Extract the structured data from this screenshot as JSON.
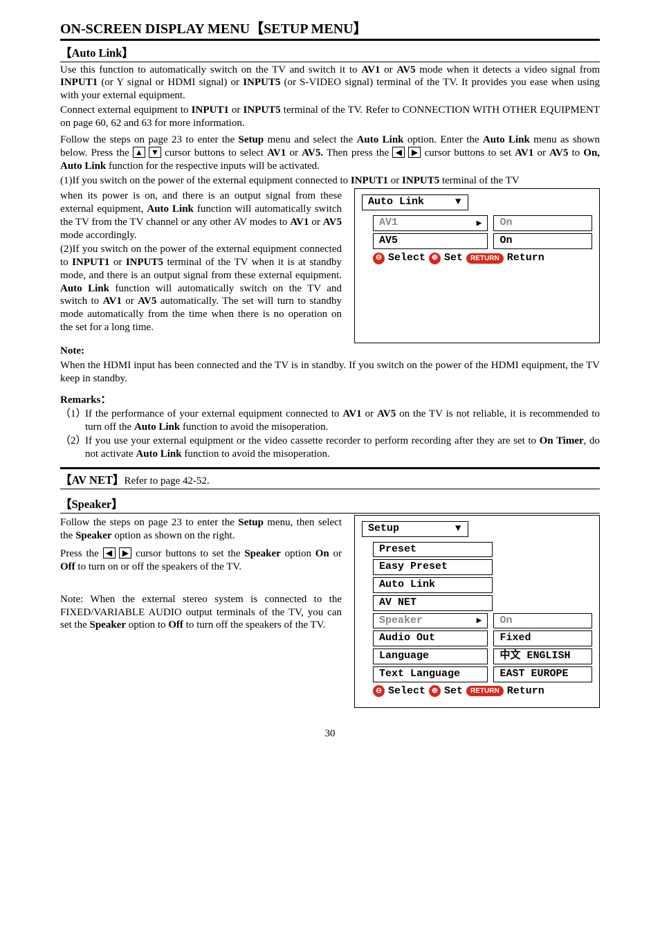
{
  "page": {
    "title": "ON-SCREEN DISPLAY MENU【SETUP MENU】",
    "number": "30"
  },
  "autolink": {
    "heading": "【Auto Link】",
    "p1a": "Use this function to automatically switch on the TV and switch it to ",
    "p1b": " or ",
    "p1c": " mode when it detects a video signal from ",
    "p1d": " (or Y signal or HDMI signal) or ",
    "p1e": " (or S-VIDEO signal) terminal of the TV. It provides you ease when using with your external equipment.",
    "p2a": "Connect external equipment to ",
    "p2b": " or ",
    "p2c": " terminal of the TV. Refer to CONNECTION WITH OTHER EQUIPMENT on page 60, 62 and 63 for more information.",
    "p3a": "Follow the steps on page 23 to enter the ",
    "p3b": " menu and select the ",
    "p3c": " option. Enter the ",
    "p3d": " menu as shown below. Press the ",
    "p3e": " cursor buttons to select ",
    "p3f": " or ",
    "p3g": " Then press the ",
    "p3h": " cursor buttons to set ",
    "p3i": " or ",
    "p3j": " to ",
    "p3k": " function for the respective inputs will be activated.",
    "case1a": "(1)If you switch on the power of the external equipment connected to ",
    "case1b": " or ",
    "case1c": " terminal of the TV when its power is on, and there is an output signal from these external equipment, ",
    "case1d": " function will automatically switch the TV from the TV channel or any other AV modes to ",
    "case1e": " or ",
    "case1f": " mode accordingly.",
    "case2a": "(2)If you switch on the power of the external equipment connected to ",
    "case2b": " or ",
    "case2c": " terminal of the TV when it is at standby mode, and there is an output signal from these external equipment. ",
    "case2d": " function will automatically switch on the TV and switch to ",
    "case2e": " or ",
    "case2f": " automatically. The set will turn to standby mode automatically from the time when there is no operation on the set for a long time.",
    "note_label": "Note:",
    "note_text": "When the HDMI input has been connected and the TV is in standby. If you switch on the power of the HDMI equipment, the TV keep in standby.",
    "remarks_label": "Remarks：",
    "r1n": "（1）",
    "r1a": "If the performance of your external equipment connected to ",
    "r1b": " or ",
    "r1c": " on the TV is not reliable, it is recommended to turn off the ",
    "r1d": " function to avoid the misoperation.",
    "r2n": "（2）",
    "r2a": "If you use your external equipment or the video cassette recorder to perform recording after they are set to ",
    "r2b": ", do not activate ",
    "r2c": " function to avoid the misoperation.",
    "osd": {
      "title": "Auto Link",
      "rows": [
        {
          "l": "AV1",
          "r": "On",
          "sel": true
        },
        {
          "l": "AV5",
          "r": "On",
          "sel": false
        }
      ],
      "select": "Select",
      "set": "Set",
      "return_pill": "RETURN",
      "return": "Return"
    }
  },
  "bold": {
    "AV1": "AV1",
    "AV5": "AV5",
    "AV5dot": "AV5.",
    "INPUT1": "INPUT1",
    "INPUT5": "INPUT5",
    "Setup": "Setup",
    "AutoLink": "Auto Link",
    "On": "On",
    "OnAutoLink": "On, Auto Link",
    "Off": "Off",
    "Speaker": "Speaker",
    "OnTimer": "On Timer"
  },
  "avnet": {
    "heading": "【AV NET】",
    "ref": "Refer to page 42-52."
  },
  "speaker": {
    "heading": "【Speaker】",
    "p1a": "Follow the steps on page 23 to enter the ",
    "p1b": " menu, then select the ",
    "p1c": " option as shown on the right.",
    "p2a": "Press the ",
    "p2b": " cursor buttons to set the ",
    "p2c": " option ",
    "p2d": " or ",
    "p2e": " to turn on or off the speakers of the TV.",
    "note_a": "Note: When the external stereo system is connected to the FIXED/VARIABLE AUDIO output terminals of the TV, you can set the ",
    "note_b": " option to ",
    "note_c": " to turn off the speakers of the TV.",
    "osd": {
      "title": "Setup",
      "items_single": [
        "Preset",
        "Easy Preset",
        "Auto Link",
        "AV NET"
      ],
      "rows": [
        {
          "l": "Speaker",
          "r": "On",
          "sel": true
        },
        {
          "l": "Audio Out",
          "r": "Fixed",
          "sel": false
        },
        {
          "l": "Language",
          "r": "中文 ENGLISH",
          "sel": false
        },
        {
          "l": "Text Language",
          "r": "EAST EUROPE",
          "sel": false
        }
      ],
      "select": "Select",
      "set": "Set",
      "return_pill": "RETURN",
      "return": "Return"
    }
  }
}
